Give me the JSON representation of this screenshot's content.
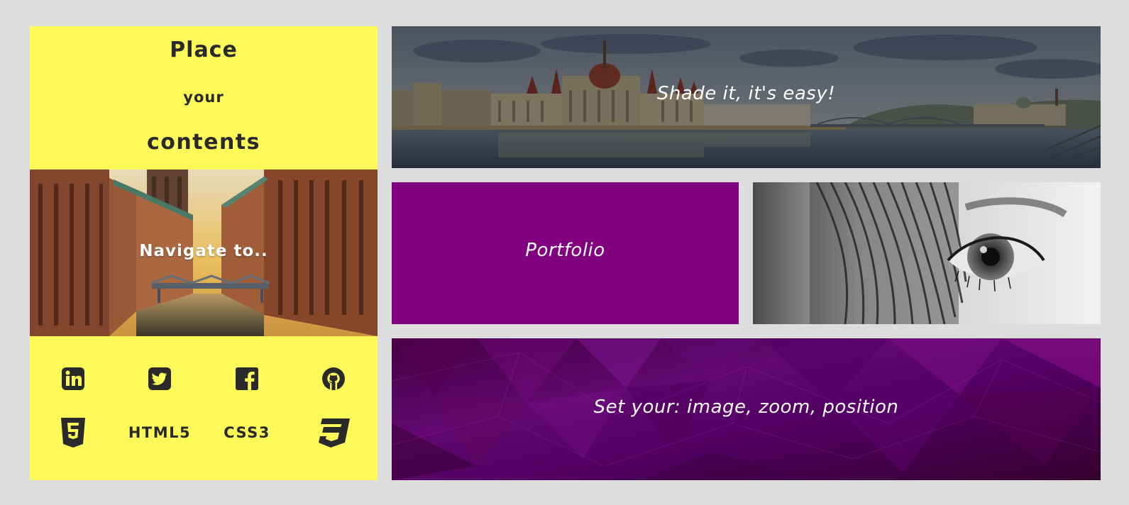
{
  "left": {
    "heading": {
      "line1": "Place",
      "line2": "your",
      "line3": "contents"
    },
    "navigate_label": "Navigate to..",
    "social_icons": [
      "linkedin-icon",
      "twitter-icon",
      "facebook-icon",
      "github-icon"
    ],
    "tech_row": {
      "html5_label": "HTML5",
      "css3_label": "CSS3",
      "icons": [
        "html5-icon",
        "css3-icon"
      ]
    }
  },
  "tiles": {
    "shade_label": "Shade it, it's easy!",
    "portfolio_label": "Portfolio",
    "set_label": "Set your: image, zoom, position"
  },
  "colors": {
    "page_background": "#dddddd",
    "accent_yellow": "#fefa5a",
    "portfolio_purple": "#800080",
    "icon_dark": "#2a2a2a",
    "label_white": "#ffffff"
  }
}
